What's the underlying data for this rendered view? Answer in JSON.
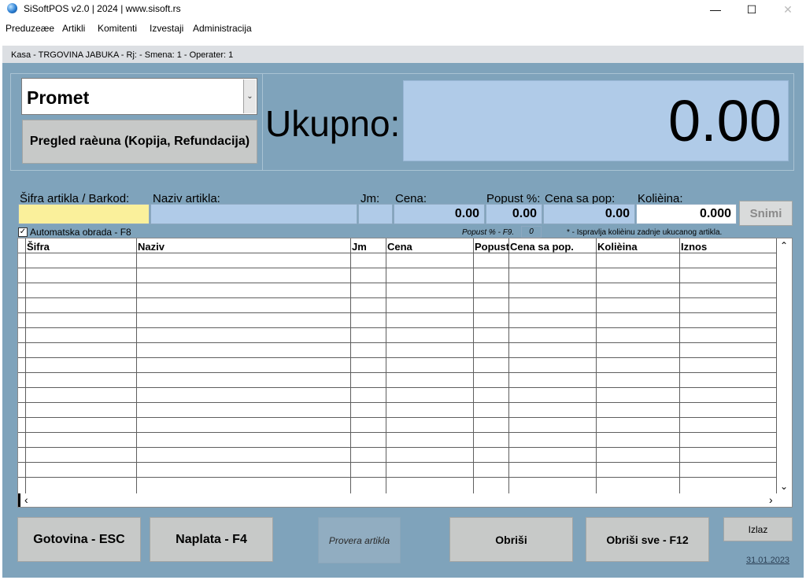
{
  "window": {
    "title": "SiSoftPOS v2.0 | 2024 | www.sisoft.rs",
    "minimize": "—",
    "maximize": "☐",
    "close": "✕"
  },
  "menu": [
    "Preduzeæe",
    "Artikli",
    "Komitenti",
    "Izvestaji",
    "Administracija"
  ],
  "status": "Kasa -  TRGOVINA JABUKA - Rj:  - Smena: 1 - Operater: 1",
  "mode_select": {
    "value": "Promet",
    "arrow": "⌄"
  },
  "review_button": "Pregled raèuna (Kopija, Refundacija)",
  "total": {
    "label": "Ukupno:",
    "value": "0.00"
  },
  "entry": {
    "labels": {
      "code": "Šifra artikla / Barkod:",
      "name": "Naziv artikla:",
      "unit": "Jm:",
      "price": "Cena:",
      "discount": "Popust %:",
      "price_disc": "Cena sa pop:",
      "qty": "Kolièina:"
    },
    "values": {
      "code": "",
      "name": "",
      "unit": "",
      "price": "0.00",
      "discount": "0.00",
      "price_disc": "0.00",
      "qty": "0.000"
    },
    "save_button": "Snimi"
  },
  "auto_process": {
    "label": "Automatska obrada - F8",
    "checked": true
  },
  "discount_hint": {
    "label": "Popust % - F9.",
    "value": "0"
  },
  "qty_hint": "*  - Ispravlja kolièinu zadnje ukucanog artikla.",
  "table": {
    "columns": [
      "Šifra",
      "Naziv",
      "Jm",
      "Cena",
      "Popust",
      "Cena sa pop.",
      "Kolièina",
      "Iznos"
    ],
    "empty_rows": 16
  },
  "scroll": {
    "up": "⌃",
    "down": "⌄",
    "left": "‹",
    "right": "›"
  },
  "buttons": {
    "cash": "Gotovina - ESC",
    "pay": "Naplata - F4",
    "check": "Provera artikla",
    "delete": "Obriši",
    "delete_all": "Obriši sve - F12",
    "exit": "Izlaz"
  },
  "date": "31.01.2023",
  "colors": {
    "panel_bg": "#7fa3bb",
    "total_bg": "#b0cbe8",
    "code_field": "#faf09b",
    "button_bg": "#c7c9c8"
  }
}
